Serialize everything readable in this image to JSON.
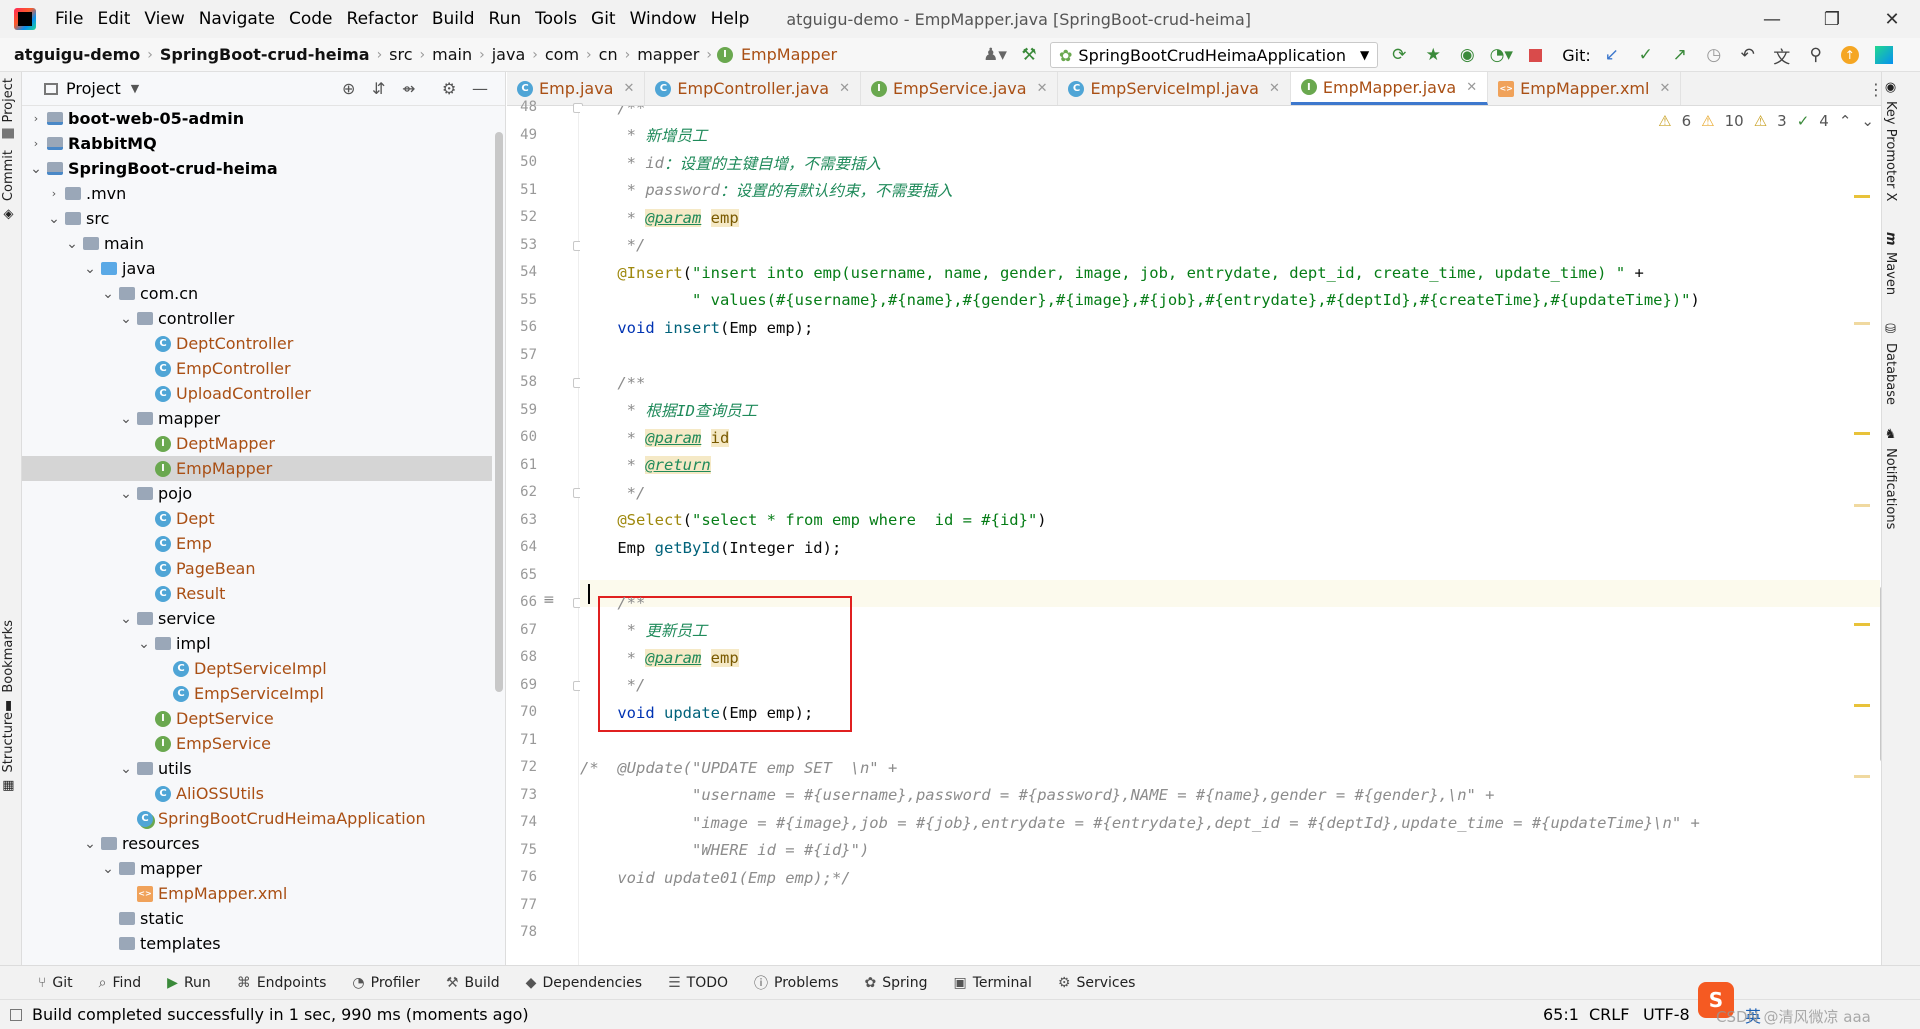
{
  "menu": [
    "File",
    "Edit",
    "View",
    "Navigate",
    "Code",
    "Refactor",
    "Build",
    "Run",
    "Tools",
    "Git",
    "Window",
    "Help"
  ],
  "window_title": "atguigu-demo - EmpMapper.java [SpringBoot-crud-heima]",
  "breadcrumb": [
    "atguigu-demo",
    "SpringBoot-crud-heima",
    "src",
    "main",
    "java",
    "com",
    "cn",
    "mapper",
    "EmpMapper"
  ],
  "run_config": "SpringBootCrudHeimaApplication",
  "git_label": "Git:",
  "project_panel": {
    "title": "Project"
  },
  "tree": [
    {
      "label": "boot-web-05-admin",
      "depth": 1,
      "chev": "›",
      "icon": "module",
      "style": "bold"
    },
    {
      "label": "RabbitMQ",
      "depth": 1,
      "chev": "›",
      "icon": "module",
      "style": "bold"
    },
    {
      "label": "SpringBoot-crud-heima",
      "depth": 1,
      "chev": "⌄",
      "icon": "module",
      "style": "bold"
    },
    {
      "label": ".mvn",
      "depth": 2,
      "chev": "›",
      "icon": "folder",
      "style": ""
    },
    {
      "label": "src",
      "depth": 2,
      "chev": "⌄",
      "icon": "folder",
      "style": ""
    },
    {
      "label": "main",
      "depth": 3,
      "chev": "⌄",
      "icon": "folder",
      "style": ""
    },
    {
      "label": "java",
      "depth": 4,
      "chev": "⌄",
      "icon": "folder-blue",
      "style": ""
    },
    {
      "label": "com.cn",
      "depth": 5,
      "chev": "⌄",
      "icon": "folder",
      "style": ""
    },
    {
      "label": "controller",
      "depth": 6,
      "chev": "⌄",
      "icon": "folder",
      "style": ""
    },
    {
      "label": "DeptController",
      "depth": 7,
      "chev": "",
      "icon": "class",
      "style": "class"
    },
    {
      "label": "EmpController",
      "depth": 7,
      "chev": "",
      "icon": "class",
      "style": "class"
    },
    {
      "label": "UploadController",
      "depth": 7,
      "chev": "",
      "icon": "class",
      "style": "class"
    },
    {
      "label": "mapper",
      "depth": 6,
      "chev": "⌄",
      "icon": "folder",
      "style": ""
    },
    {
      "label": "DeptMapper",
      "depth": 7,
      "chev": "",
      "icon": "interface",
      "style": "class"
    },
    {
      "label": "EmpMapper",
      "depth": 7,
      "chev": "",
      "icon": "interface",
      "style": "class",
      "selected": true
    },
    {
      "label": "pojo",
      "depth": 6,
      "chev": "⌄",
      "icon": "folder",
      "style": ""
    },
    {
      "label": "Dept",
      "depth": 7,
      "chev": "",
      "icon": "class",
      "style": "class"
    },
    {
      "label": "Emp",
      "depth": 7,
      "chev": "",
      "icon": "class",
      "style": "class"
    },
    {
      "label": "PageBean",
      "depth": 7,
      "chev": "",
      "icon": "class",
      "style": "class"
    },
    {
      "label": "Result",
      "depth": 7,
      "chev": "",
      "icon": "class",
      "style": "class"
    },
    {
      "label": "service",
      "depth": 6,
      "chev": "⌄",
      "icon": "folder",
      "style": ""
    },
    {
      "label": "impl",
      "depth": 7,
      "chev": "⌄",
      "icon": "folder",
      "style": ""
    },
    {
      "label": "DeptServiceImpl",
      "depth": 8,
      "chev": "",
      "icon": "class",
      "style": "class"
    },
    {
      "label": "EmpServiceImpl",
      "depth": 8,
      "chev": "",
      "icon": "class",
      "style": "class"
    },
    {
      "label": "DeptService",
      "depth": 7,
      "chev": "",
      "icon": "interface",
      "style": "class"
    },
    {
      "label": "EmpService",
      "depth": 7,
      "chev": "",
      "icon": "interface",
      "style": "class"
    },
    {
      "label": "utils",
      "depth": 6,
      "chev": "⌄",
      "icon": "folder",
      "style": ""
    },
    {
      "label": "AliOSSUtils",
      "depth": 7,
      "chev": "",
      "icon": "class",
      "style": "class"
    },
    {
      "label": "SpringBootCrudHeimaApplication",
      "depth": 6,
      "chev": "",
      "icon": "app",
      "style": "class"
    },
    {
      "label": "resources",
      "depth": 4,
      "chev": "⌄",
      "icon": "folder",
      "style": ""
    },
    {
      "label": "mapper",
      "depth": 5,
      "chev": "⌄",
      "icon": "folder",
      "style": ""
    },
    {
      "label": "EmpMapper.xml",
      "depth": 6,
      "chev": "",
      "icon": "xml",
      "style": "class"
    },
    {
      "label": "static",
      "depth": 5,
      "chev": "",
      "icon": "folder",
      "style": ""
    },
    {
      "label": "templates",
      "depth": 5,
      "chev": "",
      "icon": "folder",
      "style": ""
    }
  ],
  "tabs": [
    {
      "label": "Emp.java",
      "icon": "C"
    },
    {
      "label": "EmpController.java",
      "icon": "C"
    },
    {
      "label": "EmpService.java",
      "icon": "I"
    },
    {
      "label": "EmpServiceImpl.java",
      "icon": "C"
    },
    {
      "label": "EmpMapper.java",
      "icon": "I",
      "active": true
    },
    {
      "label": "EmpMapper.xml",
      "icon": "X"
    }
  ],
  "inspections": {
    "weak": "6",
    "warn": "10",
    "typo": "3",
    "ok": "4"
  },
  "code": [
    {
      "n": "48",
      "segs": [
        [
          "cm",
          "    /**"
        ]
      ]
    },
    {
      "n": "49",
      "segs": [
        [
          "cm",
          "     * "
        ],
        [
          "cmdoc",
          "新增员工"
        ]
      ]
    },
    {
      "n": "50",
      "segs": [
        [
          "cm",
          "     * id"
        ],
        [
          "cmdoc",
          "：设置的主键自增，不需要插入"
        ]
      ]
    },
    {
      "n": "51",
      "segs": [
        [
          "cm",
          "     * password"
        ],
        [
          "cmdoc",
          "：设置的有默认约束，不需要插入"
        ]
      ]
    },
    {
      "n": "52",
      "segs": [
        [
          "cm",
          "     * "
        ],
        [
          "tag",
          "@param"
        ],
        [
          "cm",
          " "
        ],
        [
          "pv",
          "emp"
        ]
      ]
    },
    {
      "n": "53",
      "segs": [
        [
          "cm",
          "     */"
        ]
      ]
    },
    {
      "n": "54",
      "segs": [
        [
          "ann",
          "    @Insert"
        ],
        [
          "",
          "("
        ],
        [
          "str",
          "\"insert into emp(username, name, gender, image, job, entrydate, dept_id, create_time, update_time) \""
        ],
        [
          "",
          " +"
        ]
      ]
    },
    {
      "n": "55",
      "segs": [
        [
          "str",
          "            \" values(#{username},#{name},#{gender},#{image},#{job},#{entrydate},#{deptId},#{createTime},#{updateTime})\""
        ],
        [
          "",
          ")"
        ]
      ]
    },
    {
      "n": "56",
      "segs": [
        [
          "kw",
          "    void "
        ],
        [
          "fn",
          "insert"
        ],
        [
          "",
          "(Emp emp);"
        ]
      ]
    },
    {
      "n": "57",
      "segs": [
        [
          "",
          ""
        ]
      ]
    },
    {
      "n": "58",
      "segs": [
        [
          "cm",
          "    /**"
        ]
      ]
    },
    {
      "n": "59",
      "segs": [
        [
          "cm",
          "     * "
        ],
        [
          "cmdoc",
          "根据ID查询员工"
        ]
      ]
    },
    {
      "n": "60",
      "segs": [
        [
          "cm",
          "     * "
        ],
        [
          "tag",
          "@param"
        ],
        [
          "cm",
          " "
        ],
        [
          "pv",
          "id"
        ]
      ]
    },
    {
      "n": "61",
      "segs": [
        [
          "cm",
          "     * "
        ],
        [
          "tag",
          "@return"
        ]
      ]
    },
    {
      "n": "62",
      "segs": [
        [
          "cm",
          "     */"
        ]
      ]
    },
    {
      "n": "63",
      "segs": [
        [
          "ann",
          "    @Select"
        ],
        [
          "",
          "("
        ],
        [
          "str",
          "\"select * from emp where  id = #{id}\""
        ],
        [
          "",
          ")"
        ]
      ]
    },
    {
      "n": "64",
      "segs": [
        [
          "",
          "    Emp "
        ],
        [
          "fn",
          "getById"
        ],
        [
          "",
          "(Integer id);"
        ]
      ]
    },
    {
      "n": "65",
      "segs": [
        [
          "",
          ""
        ]
      ]
    },
    {
      "n": "66",
      "segs": [
        [
          "cm",
          "    /**"
        ]
      ]
    },
    {
      "n": "67",
      "segs": [
        [
          "cm",
          "     * "
        ],
        [
          "cmdoc",
          "更新员工"
        ]
      ]
    },
    {
      "n": "68",
      "segs": [
        [
          "cm",
          "     * "
        ],
        [
          "tag",
          "@param"
        ],
        [
          "cm",
          " "
        ],
        [
          "pv",
          "emp"
        ]
      ]
    },
    {
      "n": "69",
      "segs": [
        [
          "cm",
          "     */"
        ]
      ]
    },
    {
      "n": "70",
      "segs": [
        [
          "kw",
          "    void "
        ],
        [
          "fn",
          "update"
        ],
        [
          "",
          "(Emp emp);"
        ]
      ]
    },
    {
      "n": "71",
      "segs": [
        [
          "",
          ""
        ]
      ]
    },
    {
      "n": "72",
      "segs": [
        [
          "cm",
          "/*  @Update(\"UPDATE emp SET  \\n\" +"
        ]
      ]
    },
    {
      "n": "73",
      "segs": [
        [
          "cm",
          "            \"username = #{username},password = #{password},NAME = #{name},gender = #{gender},\\n\" +"
        ]
      ]
    },
    {
      "n": "74",
      "segs": [
        [
          "cm",
          "            \"image = #{image},job = #{job},entrydate = #{entrydate},dept_id = #{deptId},update_time = #{updateTime}\\n\" +"
        ]
      ]
    },
    {
      "n": "75",
      "segs": [
        [
          "cm",
          "            \"WHERE id = #{id}\")"
        ]
      ]
    },
    {
      "n": "76",
      "segs": [
        [
          "cm",
          "    void update01(Emp emp);*/"
        ]
      ]
    },
    {
      "n": "77",
      "segs": [
        [
          "",
          ""
        ]
      ]
    },
    {
      "n": "78",
      "segs": [
        [
          "",
          ""
        ]
      ]
    }
  ],
  "right_tools": [
    "Key Promoter X",
    "Maven",
    "Database",
    "Notifications"
  ],
  "left_tools": {
    "top": [
      "Project",
      "Commit"
    ],
    "bottom": [
      "Bookmarks",
      "Structure"
    ]
  },
  "bottom_tabs": [
    "Git",
    "Find",
    "Run",
    "Endpoints",
    "Profiler",
    "Build",
    "Dependencies",
    "TODO",
    "Problems",
    "Spring",
    "Terminal",
    "Services"
  ],
  "status": {
    "message": "Build completed successfully in 1 sec, 990 ms (moments ago)",
    "position": "65:1",
    "line_sep": "CRLF",
    "encoding": "UTF-8",
    "ime": "英",
    "watermark": "CSDN @清风微凉 aaa"
  },
  "colors": {
    "selection": "#d5d5d5",
    "highlight_box": "#e02020",
    "active_tab_underline": "#3d78cd"
  }
}
